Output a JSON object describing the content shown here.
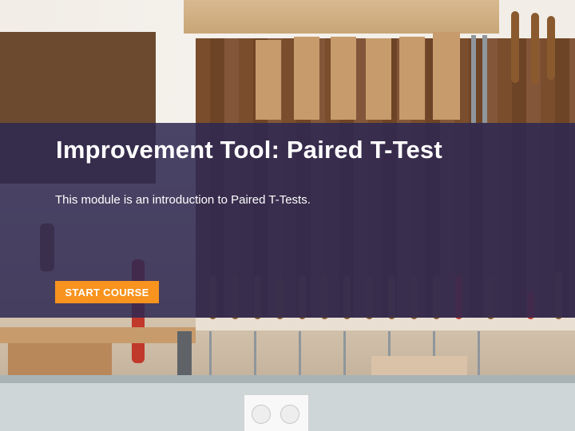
{
  "course": {
    "title": "Improvement Tool: Paired T-Test",
    "description": "This module is an introduction to Paired T-Tests.",
    "start_label": "START COURSE"
  },
  "colors": {
    "overlay": "#2d2852",
    "button": "#f7931e",
    "text": "#ffffff"
  }
}
